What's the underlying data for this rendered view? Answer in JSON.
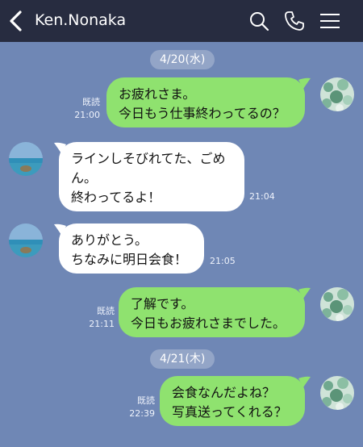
{
  "header": {
    "back_icon": "chevron-left-icon",
    "title": "Ken.Nonaka",
    "icons": [
      "search-icon",
      "phone-icon",
      "menu-icon"
    ]
  },
  "dates": [
    "4/20(水)",
    "4/21(木)"
  ],
  "messages": [
    {
      "from": "me",
      "text": "お疲れさま。\n今日もう仕事終わってるの？",
      "read": "既読",
      "time": "21:00"
    },
    {
      "from": "them",
      "text": "ラインしそびれてた、ごめ\nん。\n終わってるよ！",
      "time": "21:04"
    },
    {
      "from": "them",
      "text": "ありがとう。\nちなみに明日会食！",
      "time": "21:05"
    },
    {
      "from": "me",
      "text": "了解です。\n今日もお疲れさまでした。",
      "read": "既読",
      "time": "21:11"
    },
    {
      "from": "me",
      "text": "会食なんだよね？\n写真送ってくれる？",
      "read": "既読",
      "time": "22:39"
    }
  ],
  "colors": {
    "header": "#272c40",
    "background": "#6f87b5",
    "my_bubble": "#8fe26f",
    "their_bubble": "#ffffff"
  }
}
